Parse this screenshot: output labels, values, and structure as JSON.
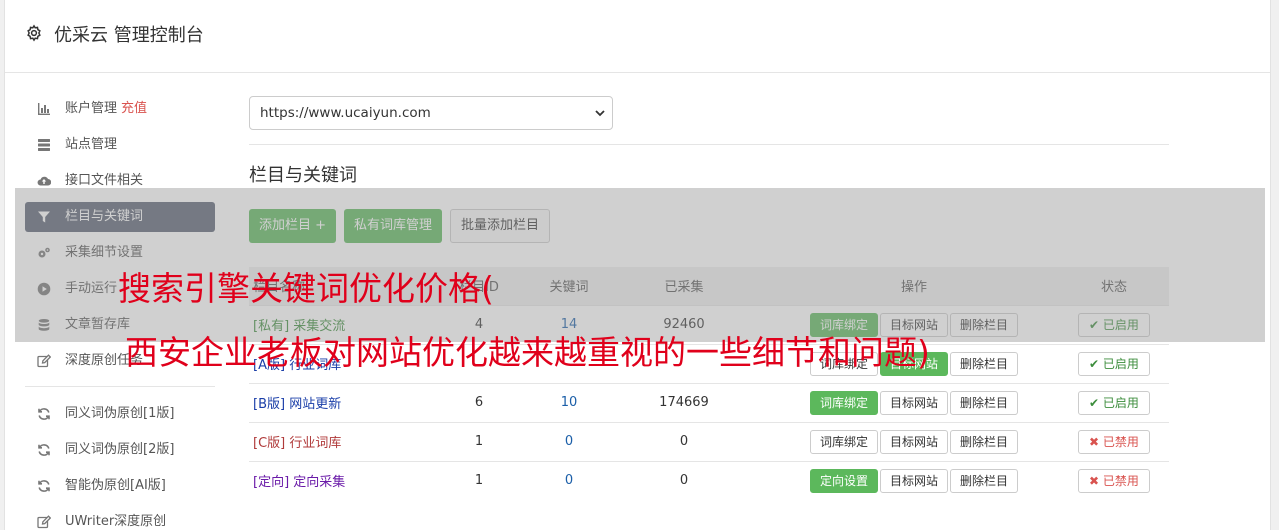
{
  "app": {
    "title": "优采云 管理控制台",
    "icon": "gear-icon"
  },
  "sidebar": {
    "group1": [
      {
        "label": "账户管理",
        "extra": "充值",
        "icon": "bar-chart-icon"
      },
      {
        "label": "站点管理",
        "icon": "server-icon"
      },
      {
        "label": "接口文件相关",
        "icon": "cloud-upload-icon"
      },
      {
        "label": "栏目与关键词",
        "icon": "filter-icon",
        "active": true
      },
      {
        "label": "采集细节设置",
        "icon": "cogs-icon"
      },
      {
        "label": "手动运行",
        "icon": "play-circle-icon"
      },
      {
        "label": "文章暂存库",
        "icon": "database-icon"
      },
      {
        "label": "深度原创任务",
        "icon": "edit-icon"
      }
    ],
    "group2": [
      {
        "label": "同义词伪原创[1版]",
        "icon": "refresh-icon"
      },
      {
        "label": "同义词伪原创[2版]",
        "icon": "refresh-icon"
      },
      {
        "label": "智能伪原创[AI版]",
        "icon": "refresh-icon"
      },
      {
        "label": "UWriter深度原创",
        "icon": "edit-icon"
      }
    ]
  },
  "site_select": {
    "value": "https://www.ucaiyun.com"
  },
  "section": {
    "title": "栏目与关键词"
  },
  "buttons": {
    "add_column": "添加栏目 +",
    "private_lib": "私有词库管理",
    "batch_add": "批量添加栏目"
  },
  "table": {
    "headers": [
      "栏目名称",
      "栏目ID",
      "关键词",
      "已采集",
      "操作",
      "状态"
    ],
    "rows": [
      {
        "tag": "[私有]",
        "name": "采集交流",
        "col2": "4",
        "col3": "14",
        "collected": "92460",
        "op1": "词库绑定",
        "op1_active": true,
        "op2": "目标网站",
        "op3": "删除栏目",
        "status": "已启用",
        "status_on": true,
        "tag_color": "green"
      },
      {
        "tag": "[A版]",
        "name": "行业词库",
        "col2": "",
        "col3": "",
        "collected": "",
        "op1": "词库绑定",
        "op1_active": false,
        "op2": "目标网站",
        "op2_active": true,
        "op3": "删除栏目",
        "status": "已启用",
        "status_on": true,
        "tag_color": "blue"
      },
      {
        "tag": "[B版]",
        "name": "网站更新",
        "col2": "6",
        "col3": "10",
        "collected": "174669",
        "op1": "词库绑定",
        "op1_active": true,
        "op2": "目标网站",
        "op3": "删除栏目",
        "status": "已启用",
        "status_on": true,
        "tag_color": "blue"
      },
      {
        "tag": "[C版]",
        "name": "行业词库",
        "col2": "1",
        "col3": "0",
        "collected": "0",
        "op1": "词库绑定",
        "op1_active": false,
        "op2": "目标网站",
        "op3": "删除栏目",
        "status": "已禁用",
        "status_on": false,
        "tag_color": "red"
      },
      {
        "tag": "[定向]",
        "name": "定向采集",
        "col2": "1",
        "col3": "0",
        "collected": "0",
        "op1": "定向设置",
        "op1_active": true,
        "op2": "目标网站",
        "op3": "删除栏目",
        "status": "已禁用",
        "status_on": false,
        "tag_color": "purple"
      }
    ]
  },
  "overlay": {
    "line1": "搜索引擎关键词优化价格(",
    "line2": "西安企业老板对网站优化越来越重视的一些细节和问题)"
  },
  "colors": {
    "accent_green": "#5cb85c",
    "active_nav": "#5a6273",
    "overlay_text": "#e0001b"
  }
}
